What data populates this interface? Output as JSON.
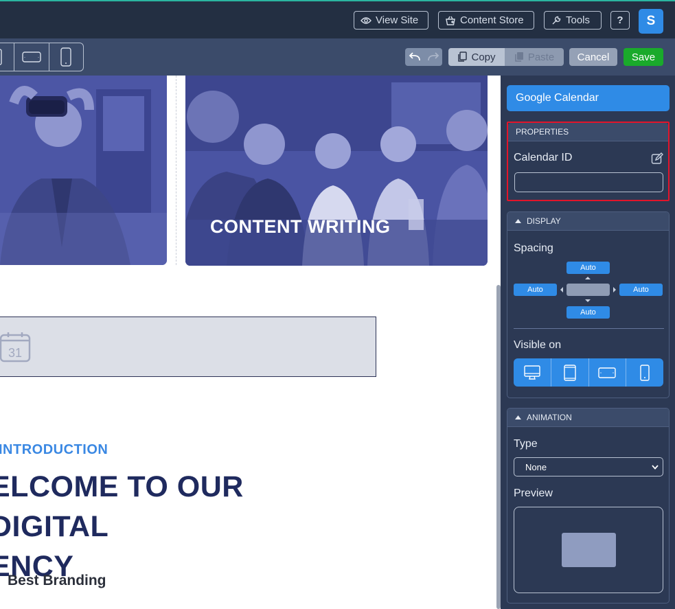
{
  "topbar": {
    "view_site": "View Site",
    "content_store": "Content Store",
    "tools": "Tools",
    "help": "?",
    "avatar_initial": "S"
  },
  "toolbar": {
    "copy": "Copy",
    "paste": "Paste",
    "cancel": "Cancel",
    "save": "Save"
  },
  "canvas": {
    "card_title": "CONTENT WRITING",
    "calendar_day": "31",
    "intro": "INTRODUCTION",
    "welcome_line1": "ELCOME TO OUR DIGITAL",
    "welcome_line2": "ENCY",
    "branding": "Best Branding"
  },
  "sidebar": {
    "widget_name": "Google Calendar",
    "properties": {
      "header": "PROPERTIES",
      "calendar_id_label": "Calendar ID",
      "calendar_id_value": ""
    },
    "display": {
      "header": "DISPLAY",
      "spacing_label": "Spacing",
      "spacing_top": "Auto",
      "spacing_left": "Auto",
      "spacing_right": "Auto",
      "spacing_bottom": "Auto",
      "visible_on_label": "Visible on"
    },
    "animation": {
      "header": "ANIMATION",
      "type_label": "Type",
      "type_value": "None",
      "preview_label": "Preview"
    }
  },
  "colors": {
    "accent": "#2f8be6",
    "save_green": "#1aaa2b",
    "highlight_red": "#e3142a",
    "heading_navy": "#1f2a5e"
  }
}
